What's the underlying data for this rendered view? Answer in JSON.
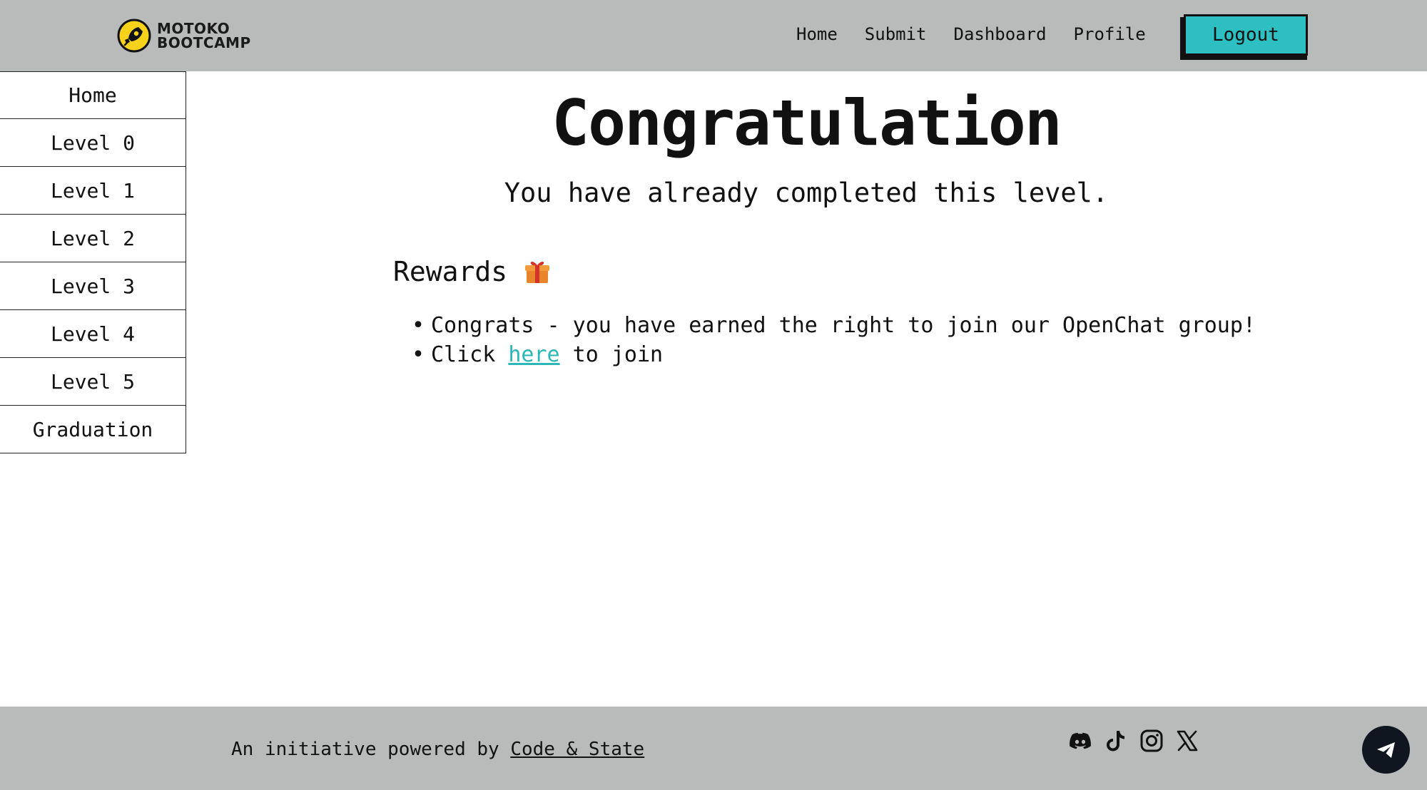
{
  "brand": {
    "line1": "MOTOKO",
    "line2": "BOOTCAMP"
  },
  "nav": {
    "items": [
      {
        "label": "Home"
      },
      {
        "label": "Submit"
      },
      {
        "label": "Dashboard"
      },
      {
        "label": "Profile"
      }
    ],
    "logout_label": "Logout"
  },
  "sidebar": {
    "items": [
      {
        "label": "Home"
      },
      {
        "label": "Level 0"
      },
      {
        "label": "Level 1"
      },
      {
        "label": "Level 2"
      },
      {
        "label": "Level 3"
      },
      {
        "label": "Level 4"
      },
      {
        "label": "Level 5"
      },
      {
        "label": "Graduation"
      }
    ]
  },
  "main": {
    "title": "Congratulation",
    "subtitle": "You have already completed this level.",
    "rewards_heading": "Rewards",
    "rewards": {
      "item1": "Congrats - you have earned the right to join our OpenChat group!",
      "item2_prefix": "Click ",
      "item2_link": "here",
      "item2_suffix": " to join"
    }
  },
  "footer": {
    "text_prefix": "An initiative powered by ",
    "link": "Code & State",
    "socials": [
      "discord-icon",
      "tiktok-icon",
      "instagram-icon",
      "x-icon"
    ]
  },
  "colors": {
    "header_bg": "#b9bbba",
    "accent": "#2dbfc1",
    "link": "#2bb7b7",
    "fab_bg": "#0f1620"
  }
}
